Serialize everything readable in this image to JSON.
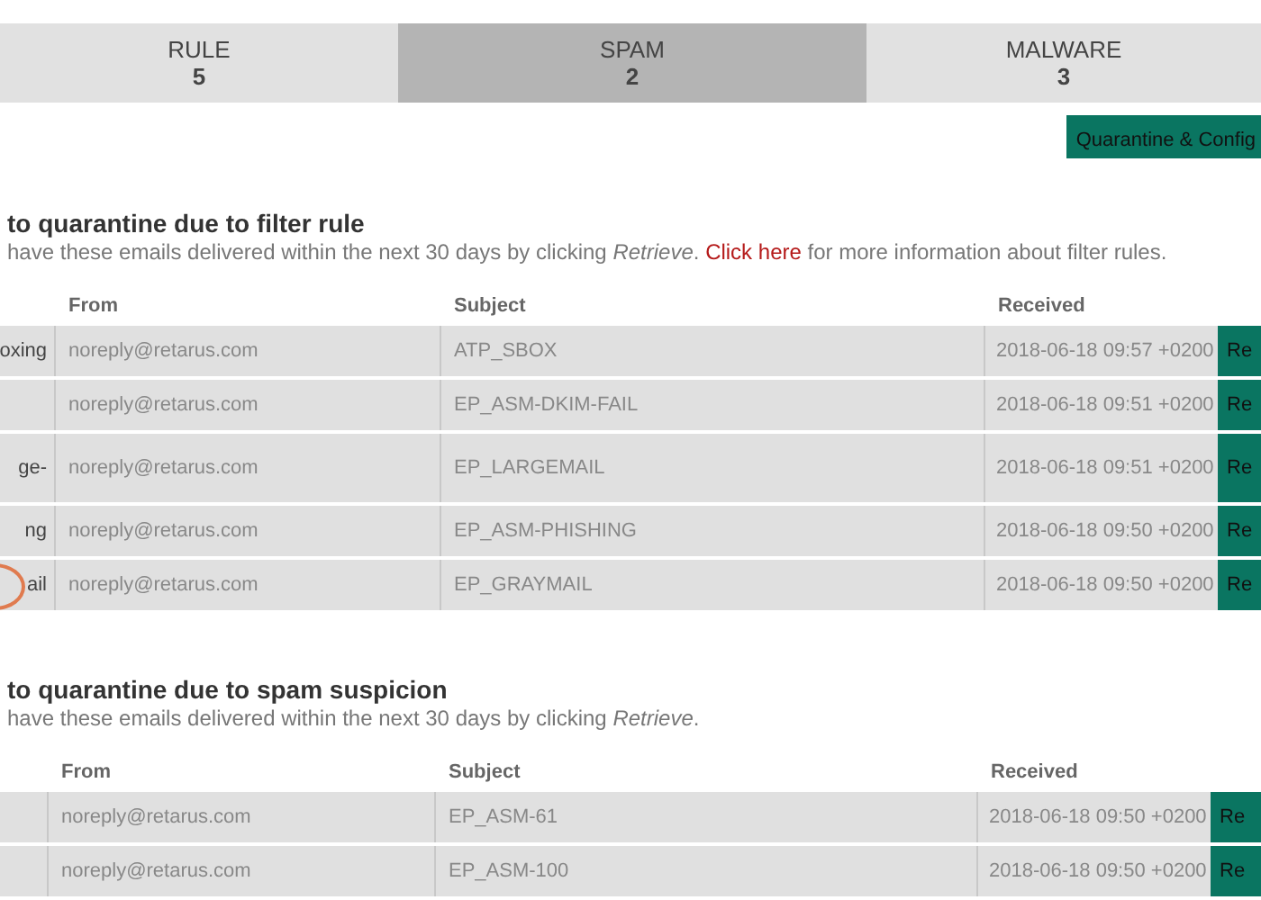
{
  "tabs": [
    {
      "label": "RULE",
      "count": "5",
      "selected": false
    },
    {
      "label": "SPAM",
      "count": "2",
      "selected": true
    },
    {
      "label": "MALWARE",
      "count": "3",
      "selected": false
    }
  ],
  "config_button": "Quarantine & Config",
  "sections": [
    {
      "title": "to quarantine due to filter rule",
      "description": "have these emails delivered within the next 30 days by clicking *Retrieve*.",
      "link": "Click here",
      "description_after": "for more information about filter rules.",
      "columns": [
        "",
        "From",
        "Subject",
        "Received"
      ],
      "rows": [
        {
          "column_1": "oxing",
          "from": "noreply@retarus.com",
          "subject": "ATP_SBOX",
          "received": "2018-06-18 09:57 +0200",
          "button": "Re",
          "tall": false,
          "circled": false
        },
        {
          "column_1": "",
          "from": "noreply@retarus.com",
          "subject": "EP_ASM-DKIM-FAIL",
          "received": "2018-06-18 09:51 +0200",
          "button": "Re",
          "tall": false,
          "circled": false
        },
        {
          "column_1": "ge-",
          "from": "noreply@retarus.com",
          "subject": "EP_LARGEMAIL",
          "received": "2018-06-18 09:51 +0200",
          "button": "Re",
          "tall": true,
          "circled": false
        },
        {
          "column_1": "ng",
          "from": "noreply@retarus.com",
          "subject": "EP_ASM-PHISHING",
          "received": "2018-06-18 09:50 +0200",
          "button": "Re",
          "tall": false,
          "circled": false
        },
        {
          "column_1": "ail",
          "from": "noreply@retarus.com",
          "subject": "EP_GRAYMAIL",
          "received": "2018-06-18 09:50 +0200",
          "button": "Re",
          "tall": false,
          "circled": true
        }
      ]
    },
    {
      "title": "to quarantine due to spam suspicion",
      "description": "have these emails delivered within the next 30 days by clicking *Retrieve*.",
      "columns": [
        "",
        "From",
        "Subject",
        "Received"
      ],
      "rows": [
        {
          "column_1": "",
          "from": "noreply@retarus.com",
          "subject": "EP_ASM-61",
          "received": "2018-06-18 09:50 +0200",
          "button": "Re",
          "tall": false,
          "circled": false
        },
        {
          "column_1": "",
          "from": "noreply@retarus.com",
          "subject": "EP_ASM-100",
          "received": "2018-06-18 09:50 +0200",
          "button": "Re",
          "tall": false,
          "circled": false
        }
      ]
    }
  ]
}
